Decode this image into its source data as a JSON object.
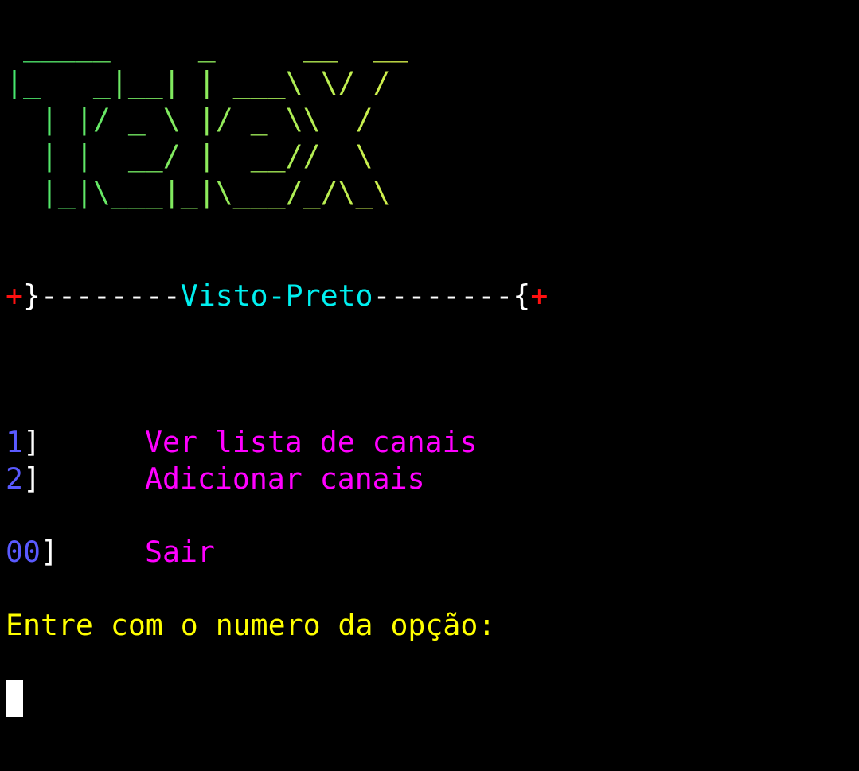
{
  "colors": {
    "background": "#000000",
    "banner_start": "#43e66e",
    "banner_end": "#d8f04a",
    "plus": "#ff1010",
    "brace": "#ffffff",
    "dashes": "#ffffff",
    "title": "#00f0f0",
    "option_number": "#5a5aff",
    "option_bracket": "#ffffff",
    "option_label": "#ff00ff",
    "prompt": "#ffff00",
    "cursor": "#ffffff"
  },
  "banner": {
    "lines": [
      " _____     _     __  __",
      "|_   _|__| | ___\\ \\/ /",
      "  | |/ _ \\ |/ _ \\\\  /",
      "  | |  __/ |  __//  \\",
      "  |_|\\___|_|\\___/_/\\_\\"
    ]
  },
  "title_bar": {
    "left_plus": "+",
    "left_brace": "}",
    "left_dashes": "--------",
    "title": "Visto-Preto",
    "right_dashes": "--------",
    "right_brace": "{",
    "right_plus": "+"
  },
  "menu": {
    "items": [
      {
        "number": "1",
        "bracket": "]",
        "label": "Ver lista de canais"
      },
      {
        "number": "2",
        "bracket": "]",
        "label": "Adicionar canais"
      }
    ],
    "exit": {
      "number": "00",
      "bracket": "]",
      "label": "Sair"
    }
  },
  "prompt": {
    "text": "Entre com o numero da opção:"
  },
  "input": {
    "value": ""
  }
}
